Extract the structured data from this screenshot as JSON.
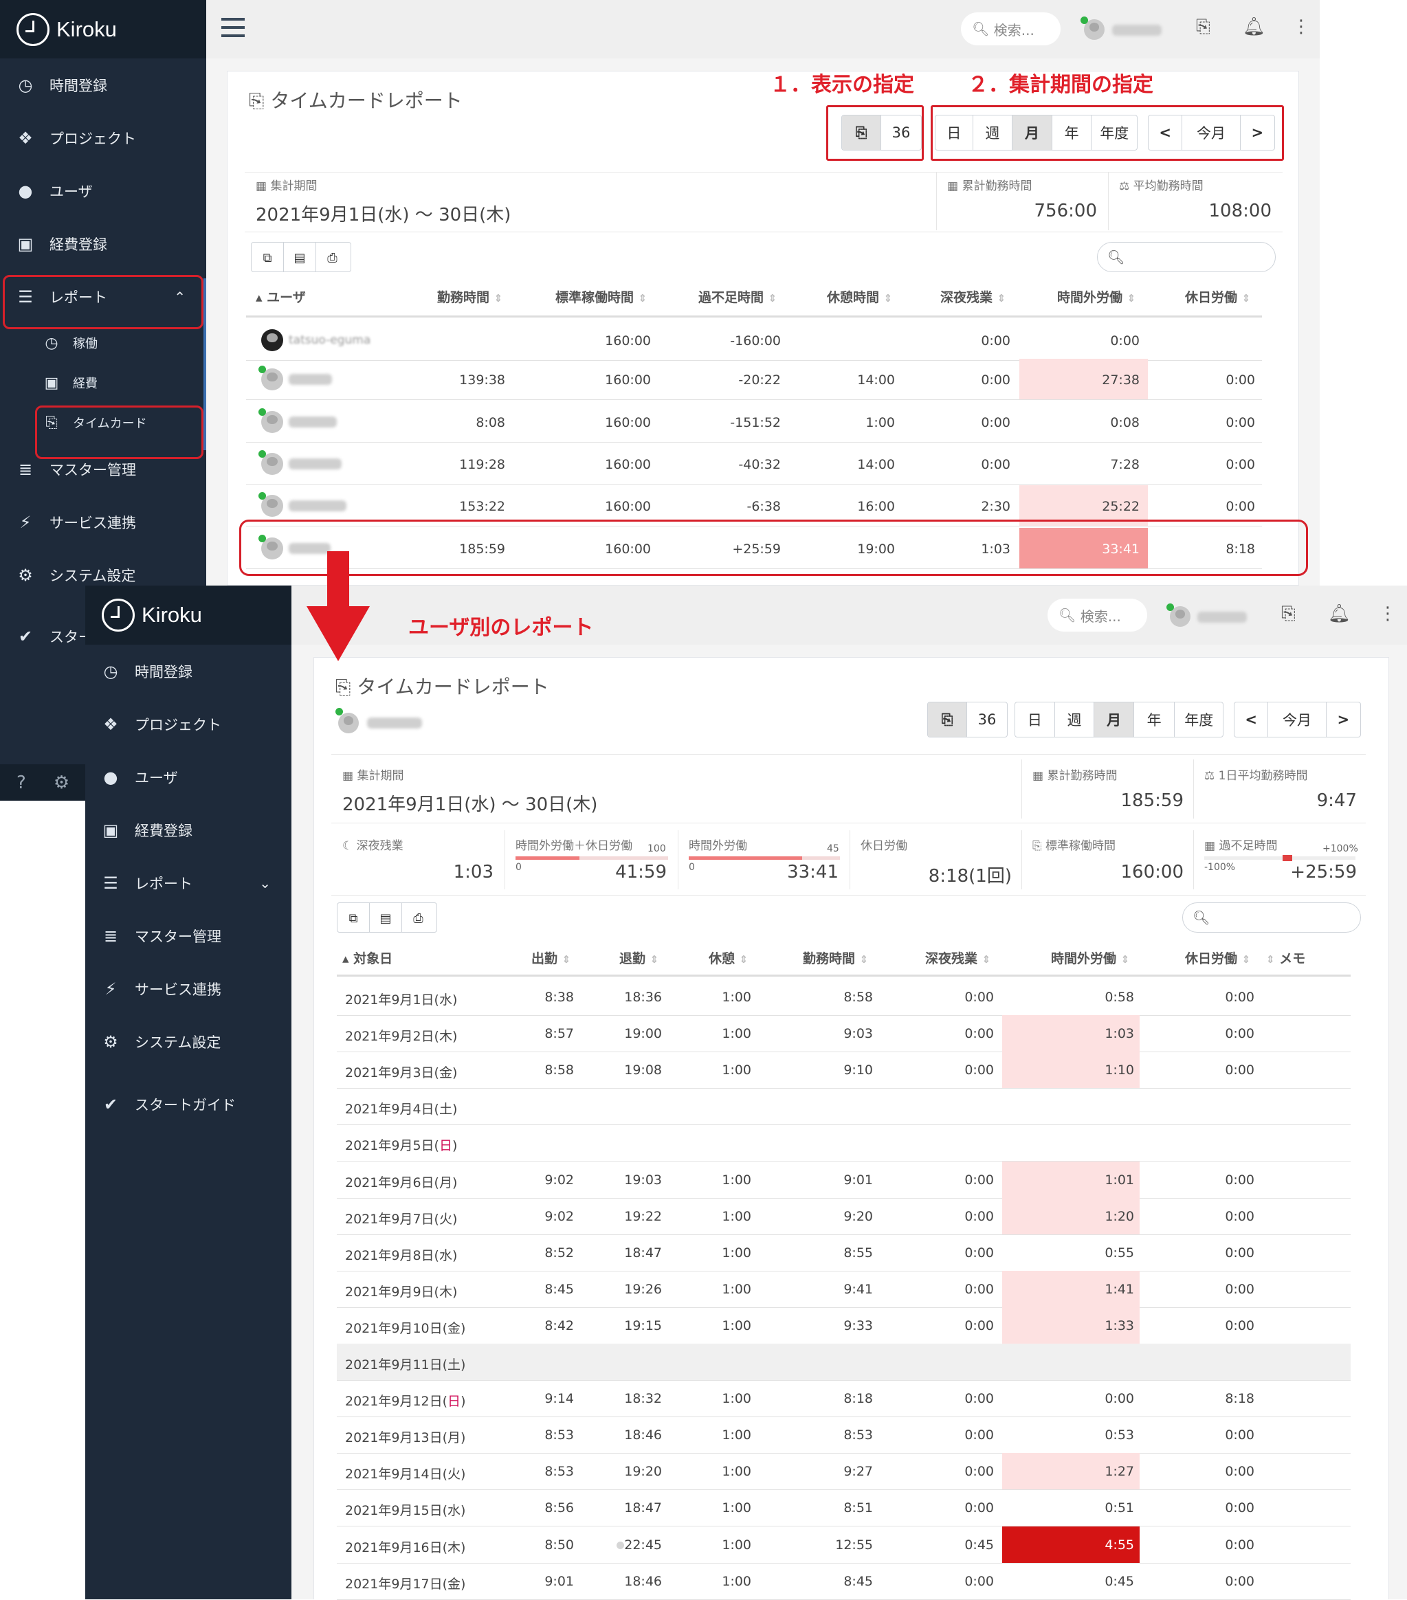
{
  "app": {
    "brand": "Kiroku"
  },
  "sidebar1": {
    "items": [
      {
        "label": "時間登録"
      },
      {
        "label": "プロジェクト"
      },
      {
        "label": "ユーザ"
      },
      {
        "label": "経費登録"
      },
      {
        "label": "レポート"
      },
      {
        "label": "マスター管理"
      },
      {
        "label": "サービス連携"
      },
      {
        "label": "システム設定"
      },
      {
        "label": "スタートガイド"
      }
    ],
    "sub_items": [
      {
        "label": "稼働"
      },
      {
        "label": "経費"
      },
      {
        "label": "タイムカード"
      }
    ],
    "footer": {
      "help": "?",
      "settings": "⚙"
    }
  },
  "sidebar2": {
    "items": [
      {
        "label": "時間登録"
      },
      {
        "label": "プロジェクト"
      },
      {
        "label": "ユーザ"
      },
      {
        "label": "経費登録"
      },
      {
        "label": "レポート"
      },
      {
        "label": "マスター管理"
      },
      {
        "label": "サービス連携"
      },
      {
        "label": "システム設定"
      },
      {
        "label": "スタートガイド"
      }
    ]
  },
  "topbar": {
    "search_placeholder": "検索..."
  },
  "annotations": {
    "display": "１．表示の指定",
    "period": "２．集計期間の指定",
    "user_report": "ユーザ別のレポート"
  },
  "report1": {
    "title": "タイムカードレポート",
    "view_count": "36",
    "period_buttons": [
      "日",
      "週",
      "月",
      "年",
      "年度"
    ],
    "active_period": "月",
    "today_label": "今月",
    "stats": {
      "period_label": "集計期間",
      "period_value": "2021年9月1日(水) 〜 30日(木)",
      "total_label": "累計勤務時間",
      "total_value": "756:00",
      "avg_label": "平均勤務時間",
      "avg_value": "108:00"
    },
    "headers": [
      "ユーザ",
      "勤務時間",
      "標準稼働時間",
      "過不足時間",
      "休憩時間",
      "深夜残業",
      "時間外労働",
      "休日労働"
    ],
    "rows": [
      {
        "name": "tatsuo-eguma",
        "work": "",
        "std": "160:00",
        "diff": "-160:00",
        "rest": "",
        "night": "0:00",
        "ot": "0:00",
        "holiday": ""
      },
      {
        "name": "",
        "work": "139:38",
        "std": "160:00",
        "diff": "-20:22",
        "rest": "14:00",
        "night": "0:00",
        "ot": "27:38",
        "holiday": "0:00"
      },
      {
        "name": "",
        "work": "8:08",
        "std": "160:00",
        "diff": "-151:52",
        "rest": "1:00",
        "night": "0:00",
        "ot": "0:08",
        "holiday": "0:00"
      },
      {
        "name": "",
        "work": "119:28",
        "std": "160:00",
        "diff": "-40:32",
        "rest": "14:00",
        "night": "0:00",
        "ot": "7:28",
        "holiday": "0:00"
      },
      {
        "name": "",
        "work": "153:22",
        "std": "160:00",
        "diff": "-6:38",
        "rest": "16:00",
        "night": "2:30",
        "ot": "25:22",
        "holiday": "0:00"
      },
      {
        "name": "",
        "work": "185:59",
        "std": "160:00",
        "diff": "+25:59",
        "rest": "19:00",
        "night": "1:03",
        "ot": "33:41",
        "holiday": "8:18"
      }
    ]
  },
  "report2": {
    "title": "タイムカードレポート",
    "view_count": "36",
    "period_buttons": [
      "日",
      "週",
      "月",
      "年",
      "年度"
    ],
    "active_period": "月",
    "today_label": "今月",
    "stats": {
      "period_label": "集計期間",
      "period_value": "2021年9月1日(水) 〜 30日(木)",
      "total_label": "累計勤務時間",
      "total_value": "185:59",
      "avg_label": "1日平均勤務時間",
      "avg_value": "9:47"
    },
    "stats2": {
      "night_label": "深夜残業",
      "night_value": "1:03",
      "otplus_label": "時間外労働＋休日労働",
      "otplus_max": "100",
      "otplus_min": "0",
      "otplus_value": "41:59",
      "otplus_fraction": 0.42,
      "ot_label": "時間外労働",
      "ot_max": "45",
      "ot_min": "0",
      "ot_value": "33:41",
      "ot_fraction": 0.75,
      "holiday_label": "休日労働",
      "holiday_value": "8:18(1回)",
      "std_label": "標準稼働時間",
      "std_value": "160:00",
      "diff_label": "過不足時間",
      "diff_max": "+100%",
      "diff_min": "-100%",
      "diff_value": "+25:59"
    },
    "headers": [
      "対象日",
      "出勤",
      "退勤",
      "休憩",
      "勤務時間",
      "深夜残業",
      "時間外労働",
      "休日労働",
      "メモ"
    ],
    "rows": [
      {
        "date": "2021年9月1日(水)",
        "in": "8:38",
        "out": "18:36",
        "rest": "1:00",
        "work": "8:58",
        "night": "0:00",
        "ot": "0:58",
        "holiday": "0:00"
      },
      {
        "date": "2021年9月2日(木)",
        "in": "8:57",
        "out": "19:00",
        "rest": "1:00",
        "work": "9:03",
        "night": "0:00",
        "ot": "1:03",
        "holiday": "0:00"
      },
      {
        "date": "2021年9月3日(金)",
        "in": "8:58",
        "out": "19:08",
        "rest": "1:00",
        "work": "9:10",
        "night": "0:00",
        "ot": "1:10",
        "holiday": "0:00"
      },
      {
        "date": "2021年9月4日(土)",
        "in": "",
        "out": "",
        "rest": "",
        "work": "",
        "night": "",
        "ot": "",
        "holiday": ""
      },
      {
        "date": "2021年9月5日(日)",
        "in": "",
        "out": "",
        "rest": "",
        "work": "",
        "night": "",
        "ot": "",
        "holiday": ""
      },
      {
        "date": "2021年9月6日(月)",
        "in": "9:02",
        "out": "19:03",
        "rest": "1:00",
        "work": "9:01",
        "night": "0:00",
        "ot": "1:01",
        "holiday": "0:00"
      },
      {
        "date": "2021年9月7日(火)",
        "in": "9:02",
        "out": "19:22",
        "rest": "1:00",
        "work": "9:20",
        "night": "0:00",
        "ot": "1:20",
        "holiday": "0:00"
      },
      {
        "date": "2021年9月8日(水)",
        "in": "8:52",
        "out": "18:47",
        "rest": "1:00",
        "work": "8:55",
        "night": "0:00",
        "ot": "0:55",
        "holiday": "0:00"
      },
      {
        "date": "2021年9月9日(木)",
        "in": "8:45",
        "out": "19:26",
        "rest": "1:00",
        "work": "9:41",
        "night": "0:00",
        "ot": "1:41",
        "holiday": "0:00"
      },
      {
        "date": "2021年9月10日(金)",
        "in": "8:42",
        "out": "19:15",
        "rest": "1:00",
        "work": "9:33",
        "night": "0:00",
        "ot": "1:33",
        "holiday": "0:00"
      },
      {
        "date": "2021年9月11日(土)",
        "in": "",
        "out": "",
        "rest": "",
        "work": "",
        "night": "",
        "ot": "",
        "holiday": ""
      },
      {
        "date": "2021年9月12日(日)",
        "in": "9:14",
        "out": "18:32",
        "rest": "1:00",
        "work": "8:18",
        "night": "0:00",
        "ot": "0:00",
        "holiday": "8:18"
      },
      {
        "date": "2021年9月13日(月)",
        "in": "8:53",
        "out": "18:46",
        "rest": "1:00",
        "work": "8:53",
        "night": "0:00",
        "ot": "0:53",
        "holiday": "0:00"
      },
      {
        "date": "2021年9月14日(火)",
        "in": "8:53",
        "out": "19:20",
        "rest": "1:00",
        "work": "9:27",
        "night": "0:00",
        "ot": "1:27",
        "holiday": "0:00"
      },
      {
        "date": "2021年9月15日(水)",
        "in": "8:56",
        "out": "18:47",
        "rest": "1:00",
        "work": "8:51",
        "night": "0:00",
        "ot": "0:51",
        "holiday": "0:00"
      },
      {
        "date": "2021年9月16日(木)",
        "in": "8:50",
        "out": "22:45",
        "rest": "1:00",
        "work": "12:55",
        "night": "0:45",
        "ot": "4:55",
        "holiday": "0:00"
      },
      {
        "date": "2021年9月17日(金)",
        "in": "9:01",
        "out": "18:46",
        "rest": "1:00",
        "work": "8:45",
        "night": "0:00",
        "ot": "0:45",
        "holiday": "0:00"
      }
    ]
  },
  "colors": {
    "sidebar": "#1e2a3a",
    "highlight_light": "#fde1e1",
    "highlight_mid": "#f59a9a",
    "highlight_strong": "#d41414",
    "annotation": "#e0202a"
  }
}
